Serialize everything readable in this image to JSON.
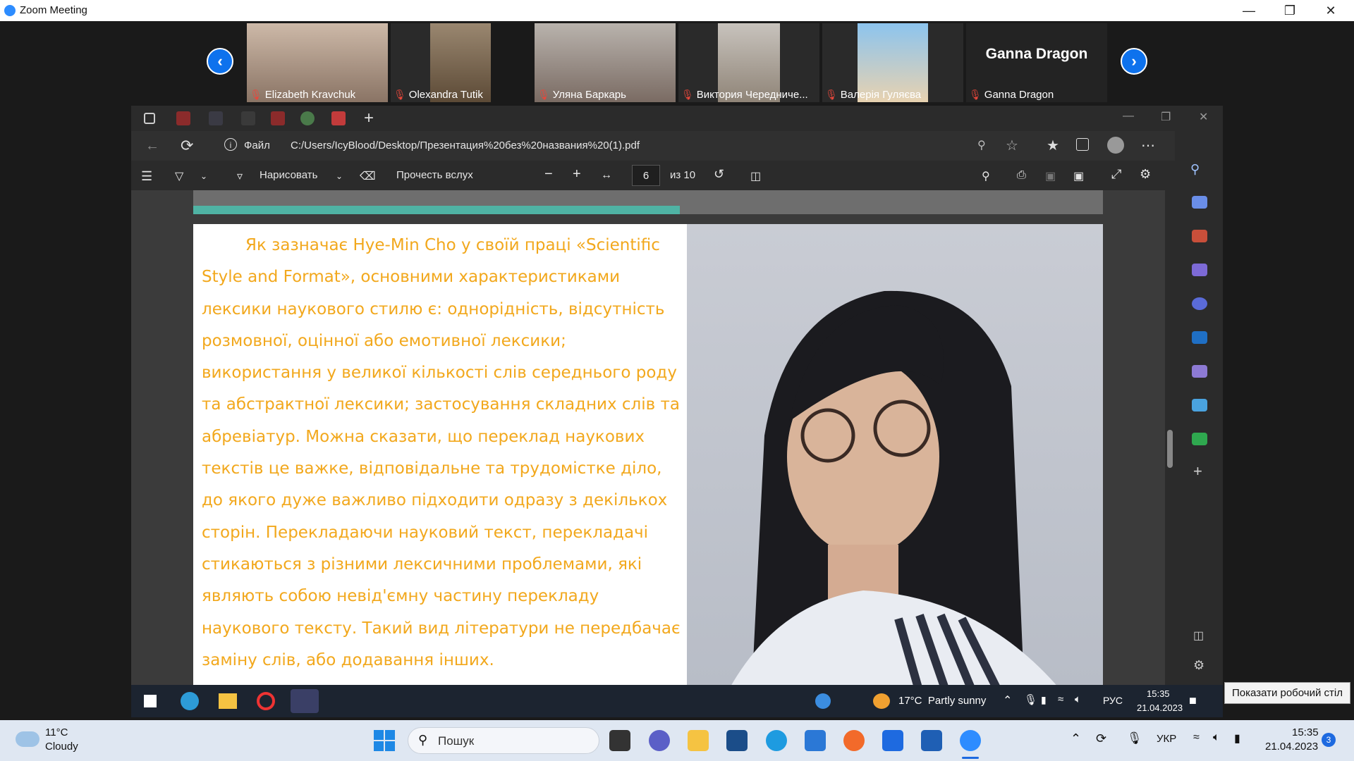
{
  "zoom": {
    "window_title": "Zoom Meeting",
    "participants": [
      {
        "name": "Elizabeth Kravchuk"
      },
      {
        "name": "Olexandra Tutik"
      },
      {
        "name": "Уляна Баркарь"
      },
      {
        "name": "Виктория Чередниче..."
      },
      {
        "name": "Валерія Гуляєва"
      },
      {
        "name": "Ganna Dragon",
        "label_big": "Ganna Dragon"
      }
    ]
  },
  "edge": {
    "file_label": "Файл",
    "url": "C:/Users/IcyBlood/Desktop/Презентация%20без%20названия%20(1).pdf"
  },
  "pdf_toolbar": {
    "draw_label": "Нарисовать",
    "read_aloud_label": "Прочесть вслух",
    "page_current": "6",
    "page_total": "из 10"
  },
  "slide": {
    "paragraph": "Як зазначає Hye-Min Cho у своїй праці «Scientific Style and Format», основними характеристиками лексики наукового стилю є: однорідність, відсутність розмовної, оцінної або емотивної лексики; використання у великої кількості слів середнього роду та абстрактної лексики; застосування складних слів та абревіатур. Можна сказати, що переклад наукових текстів це важке, відповідальне та трудомістке діло, до якого дуже важливо підходити одразу з декількох сторін. Перекладаючи науковий текст, перекладачі стикаються з різними лексичними проблемами, які являють собою невід'ємну частину перекладу наукового тексту. Такий вид літератури не передбачає заміну слів, або додавання інших."
  },
  "inner_taskbar": {
    "weather": "17°C  Partly sunny",
    "lang": "РУС",
    "time": "15:35",
    "date": "21.04.2023"
  },
  "tooltip": "Показати робочий стіл",
  "taskbar": {
    "weather_temp": "11°C",
    "weather_desc": "Cloudy",
    "search_placeholder": "Пошук",
    "lang": "УКР",
    "time": "15:35",
    "date": "21.04.2023",
    "notif_count": "3"
  },
  "colors": {
    "zoom_blue": "#0e72ed",
    "slide_text": "#f2a81d",
    "slide_teal": "#4fb3a4",
    "mic_off": "#e8473b"
  }
}
